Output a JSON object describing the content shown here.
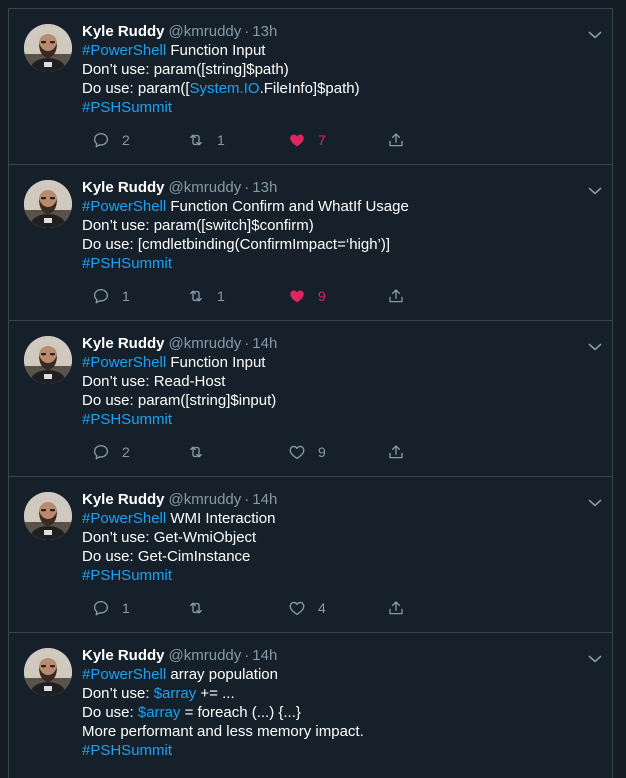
{
  "colors": {
    "background": "#15202b",
    "text": "#ffffff",
    "muted": "#8899a6",
    "link": "#1da1f2",
    "liked": "#e0245e",
    "border": "#38444d"
  },
  "icons": {
    "reply": "reply-icon",
    "retweet": "retweet-icon",
    "like": "heart-icon",
    "share": "share-icon",
    "menu": "chevron-down-icon"
  },
  "tweets": [
    {
      "name": "Kyle Ruddy",
      "handle": "@kmruddy",
      "time": "13h",
      "lines": [
        [
          {
            "t": "#PowerShell",
            "tag": true
          },
          {
            "t": " Function Input"
          }
        ],
        [
          {
            "t": "Don’t use: param([string]$path)"
          }
        ],
        [
          {
            "t": "Do use: param(["
          },
          {
            "t": "System.IO",
            "tag": true
          },
          {
            "t": ".FileInfo]$path)"
          }
        ],
        [
          {
            "t": "#PSHSummit",
            "tag": true
          }
        ]
      ],
      "replies": "2",
      "retweets": "1",
      "likes": "7",
      "liked": true
    },
    {
      "name": "Kyle Ruddy",
      "handle": "@kmruddy",
      "time": "13h",
      "lines": [
        [
          {
            "t": "#PowerShell",
            "tag": true
          },
          {
            "t": " Function Confirm and WhatIf Usage"
          }
        ],
        [
          {
            "t": "Don’t use: param([switch]$confirm)"
          }
        ],
        [
          {
            "t": "Do use: [cmdletbinding(ConfirmImpact=‘high’)]"
          }
        ],
        [
          {
            "t": "#PSHSummit",
            "tag": true
          }
        ]
      ],
      "replies": "1",
      "retweets": "1",
      "likes": "9",
      "liked": true
    },
    {
      "name": "Kyle Ruddy",
      "handle": "@kmruddy",
      "time": "14h",
      "lines": [
        [
          {
            "t": "#PowerShell",
            "tag": true
          },
          {
            "t": " Function Input"
          }
        ],
        [
          {
            "t": "Don’t use: Read-Host"
          }
        ],
        [
          {
            "t": "Do use: param([string]$input)"
          }
        ],
        [
          {
            "t": "#PSHSummit",
            "tag": true
          }
        ]
      ],
      "replies": "2",
      "retweets": "",
      "likes": "9",
      "liked": false
    },
    {
      "name": "Kyle Ruddy",
      "handle": "@kmruddy",
      "time": "14h",
      "lines": [
        [
          {
            "t": "#PowerShell",
            "tag": true
          },
          {
            "t": " WMI Interaction"
          }
        ],
        [
          {
            "t": "Don’t use: Get-WmiObject"
          }
        ],
        [
          {
            "t": "Do use: Get-CimInstance"
          }
        ],
        [
          {
            "t": "#PSHSummit",
            "tag": true
          }
        ]
      ],
      "replies": "1",
      "retweets": "",
      "likes": "4",
      "liked": false
    },
    {
      "name": "Kyle Ruddy",
      "handle": "@kmruddy",
      "time": "14h",
      "lines": [
        [
          {
            "t": "#PowerShell",
            "tag": true
          },
          {
            "t": " array population"
          }
        ],
        [
          {
            "t": "Don’t use: "
          },
          {
            "t": "$array",
            "tag": true
          },
          {
            "t": " += ..."
          }
        ],
        [
          {
            "t": "Do use: "
          },
          {
            "t": "$array",
            "tag": true
          },
          {
            "t": " = foreach (...) {...}"
          }
        ],
        [
          {
            "t": "More performant and less memory impact."
          }
        ],
        [
          {
            "t": "#PSHSummit",
            "tag": true
          }
        ]
      ],
      "replies": "",
      "retweets": "",
      "likes": "",
      "liked": false
    }
  ]
}
